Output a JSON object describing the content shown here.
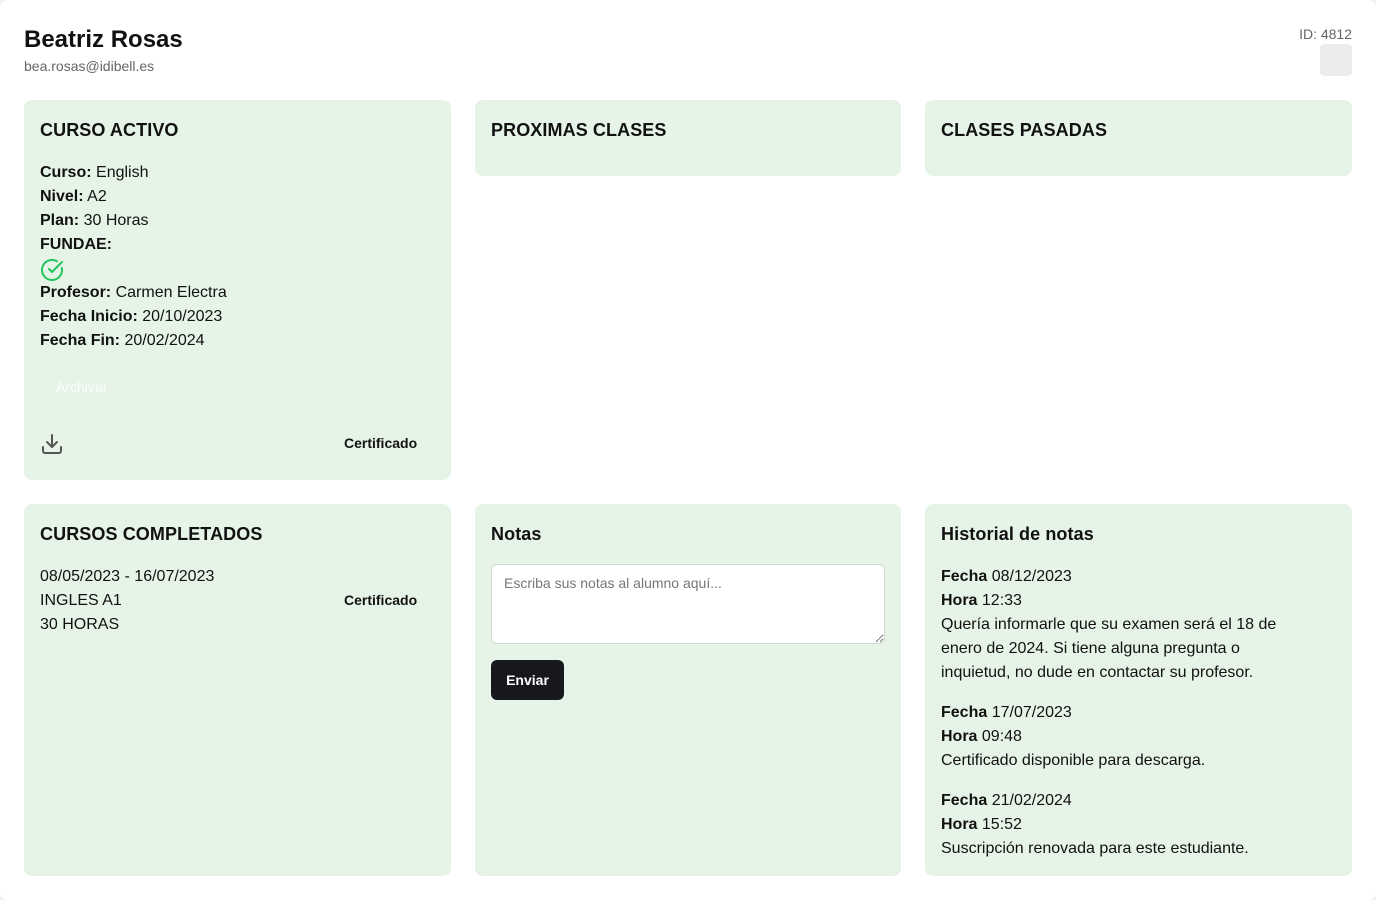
{
  "student": {
    "name": "Beatriz Rosas",
    "email": "bea.rosas@idibell.es",
    "id_label": "ID: 4812"
  },
  "active_course": {
    "title": "CURSO ACTIVO",
    "curso_label": "Curso:",
    "curso_value": "English",
    "nivel_label": "Nivel:",
    "nivel_value": "A2",
    "plan_label": "Plan:",
    "plan_value": "30 Horas",
    "fundae_label": "FUNDAE:",
    "fundae_icon": "check-circle-icon",
    "fundae_color": "#22c55e",
    "profesor_label": "Profesor:",
    "profesor_value": "Carmen Electra",
    "inicio_label": "Fecha Inicio:",
    "inicio_value": "20/10/2023",
    "fin_label": "Fecha Fin:",
    "fin_value": "20/02/2024",
    "archive_label": "Archivar",
    "download_icon": "download-icon",
    "certificate_label": "Certificado"
  },
  "upcoming": {
    "title": "PROXIMAS CLASES"
  },
  "past": {
    "title": "CLASES PASADAS"
  },
  "completed": {
    "title": "CURSOS COMPLETADOS",
    "items": [
      {
        "dates": "08/05/2023 - 16/07/2023",
        "name": "INGLES A1",
        "hours": "30 HORAS",
        "certificate_label": "Certificado"
      }
    ]
  },
  "notes": {
    "title": "Notas",
    "placeholder": "Escriba sus notas al alumno aquí...",
    "value": "",
    "send_label": "Enviar"
  },
  "history": {
    "title": "Historial de notas",
    "fecha_label": "Fecha",
    "hora_label": "Hora",
    "entries": [
      {
        "fecha": "08/12/2023",
        "hora": "12:33",
        "text": "Quería informarle que su examen será el 18 de enero de 2024. Si tiene alguna pregunta o inquietud, no dude en contactar su profesor."
      },
      {
        "fecha": "17/07/2023",
        "hora": "09:48",
        "text": "Certificado disponible para descarga."
      },
      {
        "fecha": "21/02/2024",
        "hora": "15:52",
        "text": "Suscripción renovada para este estudiante."
      }
    ]
  },
  "colors": {
    "card_bg": "#e6f4e7",
    "button_dark": "#17181c",
    "accent_check": "#22c55e"
  }
}
